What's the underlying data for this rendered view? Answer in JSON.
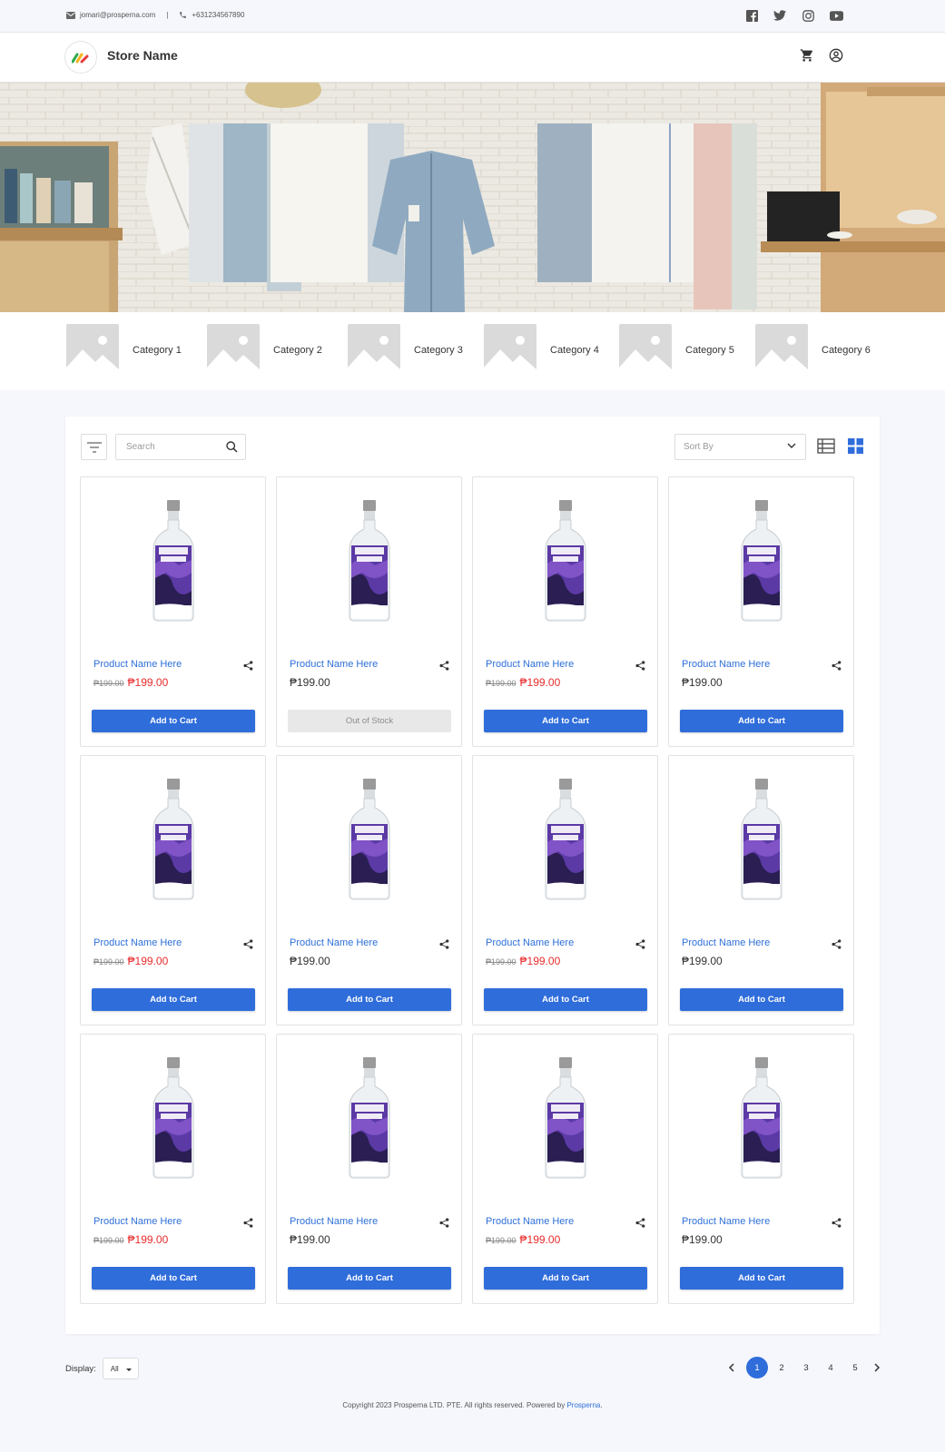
{
  "topbar": {
    "email": "jomari@prosperna.com",
    "separator": "|",
    "phone": "+631234567890",
    "social_icons": [
      "facebook-icon",
      "twitter-icon",
      "instagram-icon",
      "youtube-icon"
    ]
  },
  "header": {
    "store_name": "Store Name",
    "icons": [
      "cart-icon",
      "account-icon"
    ]
  },
  "categories": [
    {
      "label": "Category 1"
    },
    {
      "label": "Category 2"
    },
    {
      "label": "Category 3"
    },
    {
      "label": "Category 4"
    },
    {
      "label": "Category 5"
    },
    {
      "label": "Category 6"
    }
  ],
  "toolbar": {
    "search_placeholder": "Search",
    "sort_placeholder": "Sort By"
  },
  "products": [
    {
      "name": "Product Name Here",
      "old_price": "₱199.00",
      "price": "₱199.00",
      "on_sale": true,
      "button": "Add to Cart",
      "in_stock": true
    },
    {
      "name": "Product Name Here",
      "old_price": "",
      "price": "₱199.00",
      "on_sale": false,
      "button": "Out of Stock",
      "in_stock": false
    },
    {
      "name": "Product Name Here",
      "old_price": "₱199.00",
      "price": "₱199.00",
      "on_sale": true,
      "button": "Add to Cart",
      "in_stock": true
    },
    {
      "name": "Product Name Here",
      "old_price": "",
      "price": "₱199.00",
      "on_sale": false,
      "button": "Add to Cart",
      "in_stock": true
    },
    {
      "name": "Product Name Here",
      "old_price": "₱199.00",
      "price": "₱199.00",
      "on_sale": true,
      "button": "Add to Cart",
      "in_stock": true
    },
    {
      "name": "Product Name Here",
      "old_price": "",
      "price": "₱199.00",
      "on_sale": false,
      "button": "Add to Cart",
      "in_stock": true
    },
    {
      "name": "Product Name Here",
      "old_price": "₱199.00",
      "price": "₱199.00",
      "on_sale": true,
      "button": "Add to Cart",
      "in_stock": true
    },
    {
      "name": "Product Name Here",
      "old_price": "",
      "price": "₱199.00",
      "on_sale": false,
      "button": "Add to Cart",
      "in_stock": true
    },
    {
      "name": "Product Name Here",
      "old_price": "₱199.00",
      "price": "₱199.00",
      "on_sale": true,
      "button": "Add to Cart",
      "in_stock": true
    },
    {
      "name": "Product Name Here",
      "old_price": "",
      "price": "₱199.00",
      "on_sale": false,
      "button": "Add to Cart",
      "in_stock": true
    },
    {
      "name": "Product Name Here",
      "old_price": "₱199.00",
      "price": "₱199.00",
      "on_sale": true,
      "button": "Add to Cart",
      "in_stock": true
    },
    {
      "name": "Product Name Here",
      "old_price": "",
      "price": "₱199.00",
      "on_sale": false,
      "button": "Add to Cart",
      "in_stock": true
    }
  ],
  "bottom": {
    "display_label": "Display:",
    "display_value": "All",
    "pages": [
      "1",
      "2",
      "3",
      "4",
      "5"
    ],
    "current_page": "1"
  },
  "footer": {
    "copyright": "Copyright  2023 Prosperna LTD. PTE. All rights reserved. Powered by ",
    "link": "Prosperna",
    "end": "."
  },
  "colors": {
    "accent": "#2f6ddb",
    "sale_price": "#ea2b2b",
    "link": "#2e6fd8"
  }
}
